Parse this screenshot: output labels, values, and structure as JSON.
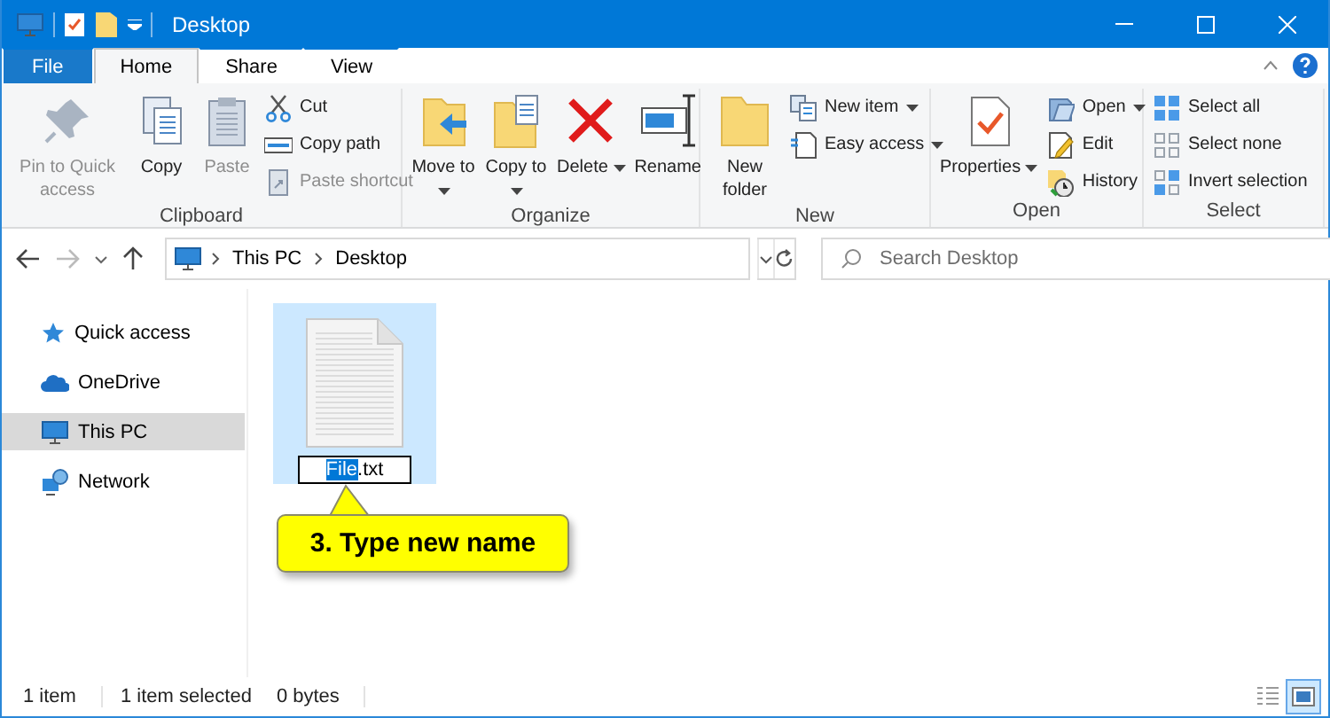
{
  "window": {
    "title": "Desktop"
  },
  "tabs": [
    {
      "label": "File",
      "kind": "file"
    },
    {
      "label": "Home",
      "kind": "tab",
      "selected": true
    },
    {
      "label": "Share",
      "kind": "tab",
      "selected": false
    },
    {
      "label": "View",
      "kind": "tab",
      "selected": false
    }
  ],
  "ribbon": [
    {
      "label": "Clipboard",
      "items": [
        {
          "kind": "large",
          "label": "Pin to Quick access",
          "disabled": true,
          "dropdown": false
        },
        {
          "kind": "large",
          "label": "Copy",
          "disabled": false,
          "dropdown": false
        },
        {
          "kind": "large",
          "label": "Paste",
          "disabled": true,
          "dropdown": false
        },
        {
          "kind": "stack",
          "items": [
            {
              "label": "Cut",
              "disabled": false,
              "dropdown": false
            },
            {
              "label": "Copy path",
              "disabled": false,
              "dropdown": false
            },
            {
              "label": "Paste shortcut",
              "disabled": true,
              "dropdown": false
            }
          ]
        }
      ]
    },
    {
      "label": "Organize",
      "items": [
        {
          "kind": "large",
          "label": "Move to",
          "disabled": false,
          "dropdown": true
        },
        {
          "kind": "large",
          "label": "Copy to",
          "disabled": false,
          "dropdown": true
        },
        {
          "kind": "large",
          "label": "Delete",
          "disabled": false,
          "dropdown": true
        },
        {
          "kind": "large",
          "label": "Rename",
          "disabled": false,
          "dropdown": false
        }
      ]
    },
    {
      "label": "New",
      "items": [
        {
          "kind": "large",
          "label": "New folder",
          "disabled": false,
          "dropdown": false
        },
        {
          "kind": "stack",
          "items": [
            {
              "label": "New item",
              "disabled": false,
              "dropdown": true
            },
            {
              "label": "Easy access",
              "disabled": false,
              "dropdown": true
            }
          ]
        }
      ]
    },
    {
      "label": "Open",
      "items": [
        {
          "kind": "large",
          "label": "Properties",
          "disabled": false,
          "dropdown": true
        },
        {
          "kind": "stack",
          "items": [
            {
              "label": "Open",
              "disabled": false,
              "dropdown": true
            },
            {
              "label": "Edit",
              "disabled": false,
              "dropdown": false
            },
            {
              "label": "History",
              "disabled": false,
              "dropdown": false
            }
          ]
        }
      ]
    },
    {
      "label": "Select",
      "items": [
        {
          "kind": "stack",
          "items": [
            {
              "label": "Select all",
              "disabled": false,
              "dropdown": false
            },
            {
              "label": "Select none",
              "disabled": false,
              "dropdown": false
            },
            {
              "label": "Invert selection",
              "disabled": false,
              "dropdown": false
            }
          ]
        }
      ]
    }
  ],
  "address": {
    "crumbs": [
      "This PC",
      "Desktop"
    ]
  },
  "search": {
    "placeholder": "Search Desktop"
  },
  "sidebar": {
    "items": [
      {
        "label": "Quick access",
        "selected": false
      },
      {
        "label": "OneDrive",
        "selected": false
      },
      {
        "label": "This PC",
        "selected": true
      },
      {
        "label": "Network",
        "selected": false
      }
    ]
  },
  "files": [
    {
      "selected": true,
      "rename_selected_part": "File",
      "rename_rest": ".txt"
    }
  ],
  "callout": {
    "text": "3. Type new name"
  },
  "status_bar": {
    "items": [
      "1 item",
      "1 item selected",
      "0 bytes"
    ],
    "view_buttons": [
      {
        "selected": false
      },
      {
        "selected": true
      }
    ]
  }
}
